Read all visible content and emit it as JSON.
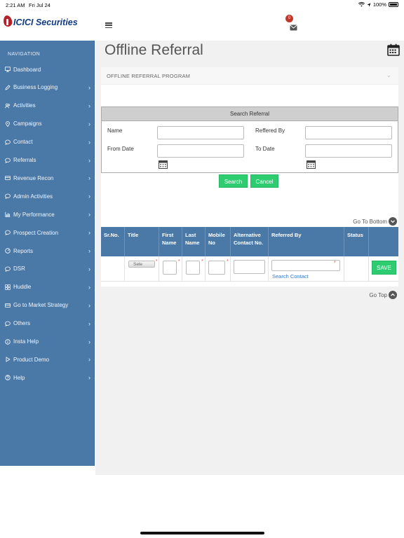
{
  "status": {
    "time": "2:21 AM",
    "date": "Fri Jul 24",
    "battery": "100%"
  },
  "header": {
    "brand": "ICICI Securities",
    "mail_count": "0"
  },
  "sidebar": {
    "heading": "NAVIGATION",
    "items": [
      {
        "label": "Dashboard",
        "icon": "monitor-icon",
        "chevron": false
      },
      {
        "label": "Business Logging",
        "icon": "pen-icon",
        "chevron": true
      },
      {
        "label": "Activities",
        "icon": "users-icon",
        "chevron": true
      },
      {
        "label": "Campaigns",
        "icon": "pin-icon",
        "chevron": true
      },
      {
        "label": "Contact",
        "icon": "chat-icon",
        "chevron": true
      },
      {
        "label": "Referrals",
        "icon": "chat-icon",
        "chevron": true
      },
      {
        "label": "Revenue Recon",
        "icon": "card-icon",
        "chevron": true
      },
      {
        "label": "Admin Activities",
        "icon": "chat-icon",
        "chevron": true
      },
      {
        "label": "My Performance",
        "icon": "chart-icon",
        "chevron": true
      },
      {
        "label": "Prospect Creation",
        "icon": "chat-icon",
        "chevron": true
      },
      {
        "label": "Reports",
        "icon": "gauge-icon",
        "chevron": true
      },
      {
        "label": "DSR",
        "icon": "chat-icon",
        "chevron": true
      },
      {
        "label": "Huddle",
        "icon": "grid-icon",
        "chevron": true
      },
      {
        "label": "Go to Market Strategy",
        "icon": "card-icon",
        "chevron": true
      },
      {
        "label": "Others",
        "icon": "chat-icon",
        "chevron": true
      },
      {
        "label": "Insta Help",
        "icon": "info-icon",
        "chevron": true
      },
      {
        "label": "Product Demo",
        "icon": "play-icon",
        "chevron": true
      },
      {
        "label": "Help",
        "icon": "help-icon",
        "chevron": true
      }
    ]
  },
  "main": {
    "title": "Offline Referral",
    "section_label": "OFFLINE REFERRAL PROGRAM",
    "search": {
      "title": "Search Referral",
      "name_label": "Name",
      "referred_by_label": "Reffered By",
      "from_date_label": "From Date",
      "to_date_label": "To Date",
      "search_button": "Search",
      "cancel_button": "Cancel"
    },
    "go_bottom": "Go To Bottom",
    "go_top": "Go Top",
    "table": {
      "columns": [
        "Sr.No.",
        "Title",
        "First Name",
        "Last Name",
        "Mobile No",
        "Alternative Contact No.",
        "Referred By",
        "Status",
        ""
      ],
      "title_select": "Sele",
      "search_contact": "Search Contact",
      "save_button": "SAVE"
    }
  },
  "colors": {
    "sidebar": "#4a79a8",
    "button": "#2ecc71",
    "badge": "#c0392b"
  }
}
